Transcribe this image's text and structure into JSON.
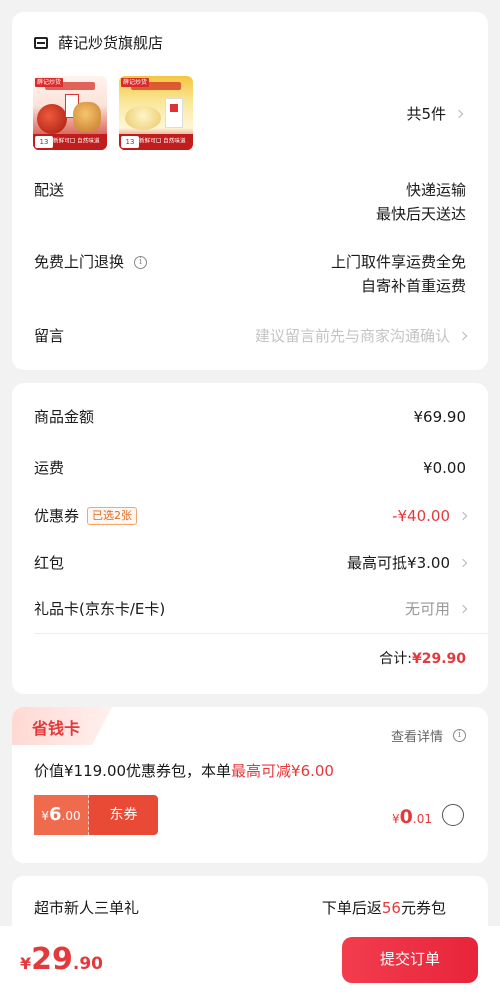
{
  "shop": {
    "name": "薛记炒货旗舰店",
    "icon": "shop-icon",
    "products": [
      {
        "icon": "product-thumbnail",
        "corner_tag": "薛记炒货",
        "price_tag": "13",
        "band_text": "新鲜可口 自然味道"
      },
      {
        "icon": "product-thumbnail",
        "corner_tag": "薛记炒货",
        "price_tag": "13",
        "band_text": "新鲜可口 自然味道"
      }
    ],
    "quantity": "共5件"
  },
  "delivery": {
    "label": "配送",
    "line1": "快递运输",
    "line2": "最快后天送达"
  },
  "returns": {
    "label": "免费上门退换",
    "line1": "上门取件享运费全免",
    "line2": "自寄补首重运费"
  },
  "message": {
    "label": "留言",
    "placeholder": "建议留言前先与商家沟通确认"
  },
  "price": {
    "goods_label": "商品金额",
    "goods_value": "¥69.90",
    "shipping_label": "运费",
    "shipping_value": "¥0.00",
    "coupon_label": "优惠券",
    "coupon_badge": "已选2张",
    "coupon_value": "-¥40.00",
    "redpacket_label": "红包",
    "redpacket_value": "最高可抵¥3.00",
    "giftcard_label": "礼品卡(京东卡/E卡)",
    "giftcard_value": "无可用",
    "subtotal_label": "合计:",
    "subtotal_value": "¥29.90"
  },
  "saving_card": {
    "title": "省钱卡",
    "detail": "查看详情",
    "desc_prefix": "价值¥119.00优惠券包，本单",
    "desc_highlight": "最高可减¥6.00",
    "ticket_cur": "¥",
    "ticket_amount": "6",
    "ticket_dec": ".00",
    "ticket_label": "东券",
    "price_cur": "¥",
    "price_int": "0",
    "price_dec": ".01",
    "selected": false
  },
  "new_user": {
    "label": "超市新人三单礼",
    "value_prefix": "下单后返",
    "value_highlight": "56",
    "value_suffix": "元券包"
  },
  "bottom": {
    "total_cur": "¥",
    "total_int": "29",
    "total_dec": ".90",
    "submit_label": "提交订单"
  },
  "colors": {
    "accent": "#e4393c",
    "background": "#f2f2f2"
  }
}
